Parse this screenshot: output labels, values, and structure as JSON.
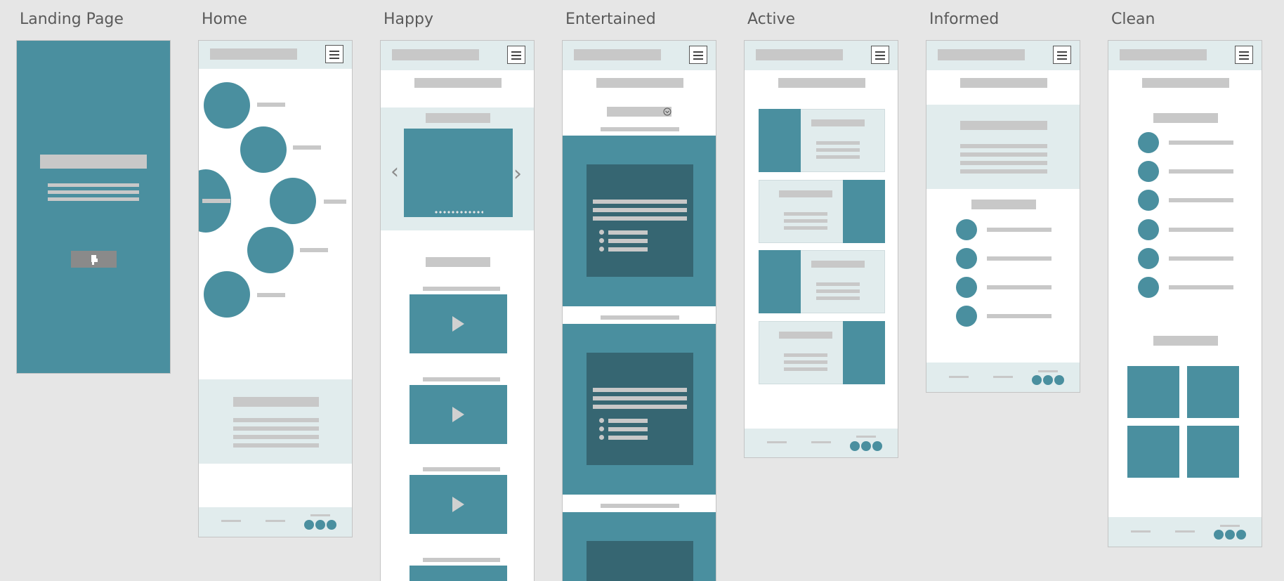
{
  "screens": [
    {
      "title": "Landing Page"
    },
    {
      "title": "Home"
    },
    {
      "title": "Happy"
    },
    {
      "title": "Entertained"
    },
    {
      "title": "Active"
    },
    {
      "title": "Informed"
    },
    {
      "title": "Clean"
    }
  ],
  "colors": {
    "canvas": "#e6e6e6",
    "teal": "#4a8f9f",
    "dark_teal": "#366672",
    "light_band": "#e1eced",
    "placeholder_grey": "#c8c8c8"
  },
  "icons": {
    "menu": "hamburger-icon",
    "tap": "hand-pointer-icon",
    "play": "play-icon",
    "prev": "chevron-left-icon",
    "next": "chevron-right-icon",
    "dropdown": "chevron-down-icon"
  }
}
